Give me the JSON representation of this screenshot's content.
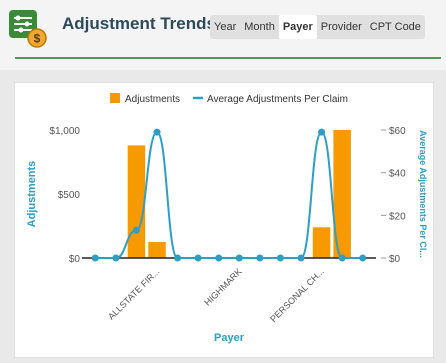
{
  "header": {
    "title": "Adjustment Trends",
    "tabs": [
      {
        "label": "Year",
        "active": false
      },
      {
        "label": "Month",
        "active": false
      },
      {
        "label": "Payer",
        "active": true
      },
      {
        "label": "Provider",
        "active": false
      },
      {
        "label": "CPT Code",
        "active": false
      }
    ]
  },
  "colors": {
    "bar": "#f79a00",
    "line": "#2f9ec4",
    "accent": "#4e9a4e",
    "title": "#2e4a5a"
  },
  "chart_data": {
    "type": "bar",
    "legend": [
      {
        "label": "Adjustments",
        "marker": "square",
        "color": "#f79a00"
      },
      {
        "label": "Average Adjustments Per Claim",
        "marker": "line",
        "color": "#2f9ec4"
      }
    ],
    "categories": [
      "",
      "",
      "",
      "ALLSTATE FIR...",
      "",
      "",
      "",
      "HIGHMARK",
      "",
      "",
      "",
      "PERSONAL CH...",
      "",
      ""
    ],
    "series": [
      {
        "name": "Adjustments",
        "type": "bar",
        "axis": "left",
        "values": [
          0,
          0,
          880,
          125,
          0,
          0,
          0,
          0,
          0,
          0,
          0,
          240,
          1000,
          0
        ]
      },
      {
        "name": "Average Adjustments Per Claim",
        "type": "line",
        "axis": "right",
        "values": [
          0,
          0,
          13,
          59,
          0,
          0,
          0,
          0,
          0,
          0,
          0,
          59,
          0,
          0
        ]
      }
    ],
    "xlabel": "Payer",
    "ylabel": "Adjustments",
    "y2label": "Average Adjustments Per Cl...",
    "ylim": [
      0,
      1000
    ],
    "y2lim": [
      0,
      60
    ],
    "yticks": [
      "$0",
      "$500",
      "$1,000"
    ],
    "y2ticks": [
      "$0",
      "$20",
      "$40",
      "$60"
    ]
  }
}
